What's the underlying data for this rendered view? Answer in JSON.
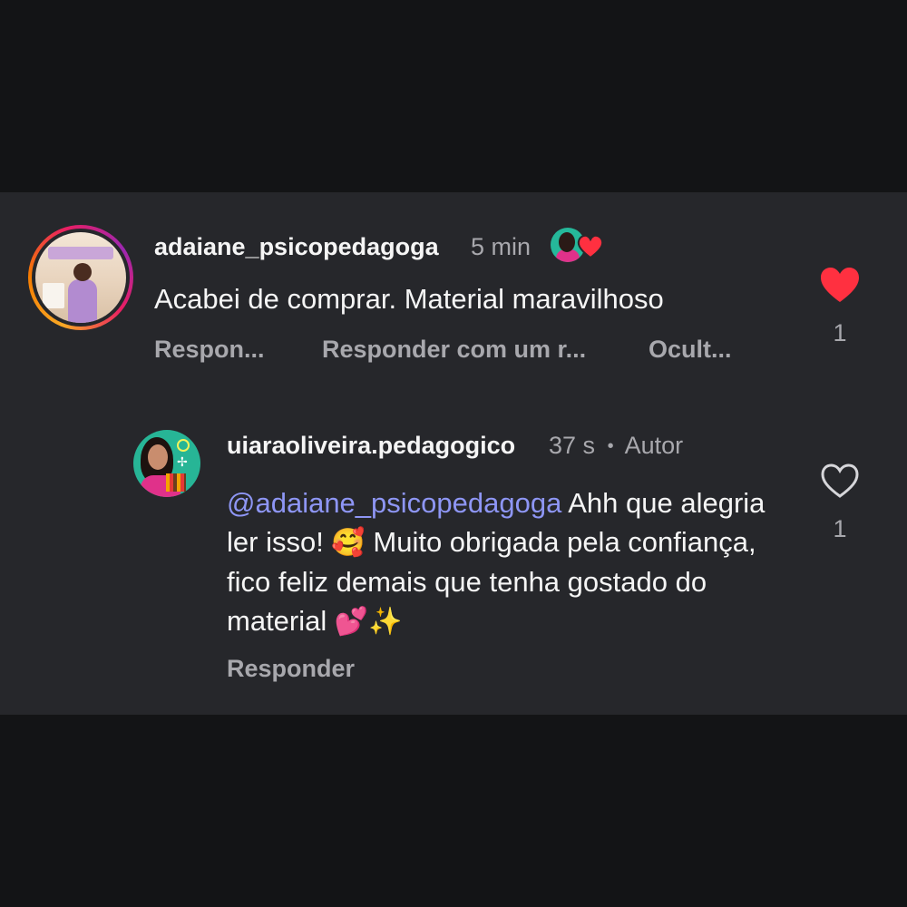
{
  "comments": [
    {
      "username": "adaiane_psicopedagoga",
      "time": "5 min",
      "text": "Acabei de comprar. Material maravilhoso",
      "actions": {
        "reply": "Respon...",
        "reply_with": "Responder com um r...",
        "hide": "Ocult..."
      },
      "likes": "1",
      "liked": true,
      "liked_by_author": true
    },
    {
      "username": "uiaraoliveira.pedagogico",
      "time": "37 s",
      "separator": "•",
      "badge": "Autor",
      "mention": "@adaiane_psicopedagoga",
      "text_part1": " Ahh que alegria ler isso! ",
      "emoji1": "🥰",
      "text_part2": " Muito obrigada pela confiança, fico feliz demais que tenha gostado do material ",
      "emoji2": "💕✨",
      "actions": {
        "reply": "Responder"
      },
      "likes": "1",
      "liked": false
    }
  ],
  "colors": {
    "background": "#131416",
    "panel": "#26272b",
    "text_primary": "#f5f5f5",
    "text_secondary": "#a8a8ad",
    "mention": "#8e96f5",
    "like_red": "#ff3040"
  },
  "icons": {
    "liked_heart": "heart-filled-icon",
    "unliked_heart": "heart-outline-icon",
    "author_liked": "author-liked-heart-icon"
  }
}
